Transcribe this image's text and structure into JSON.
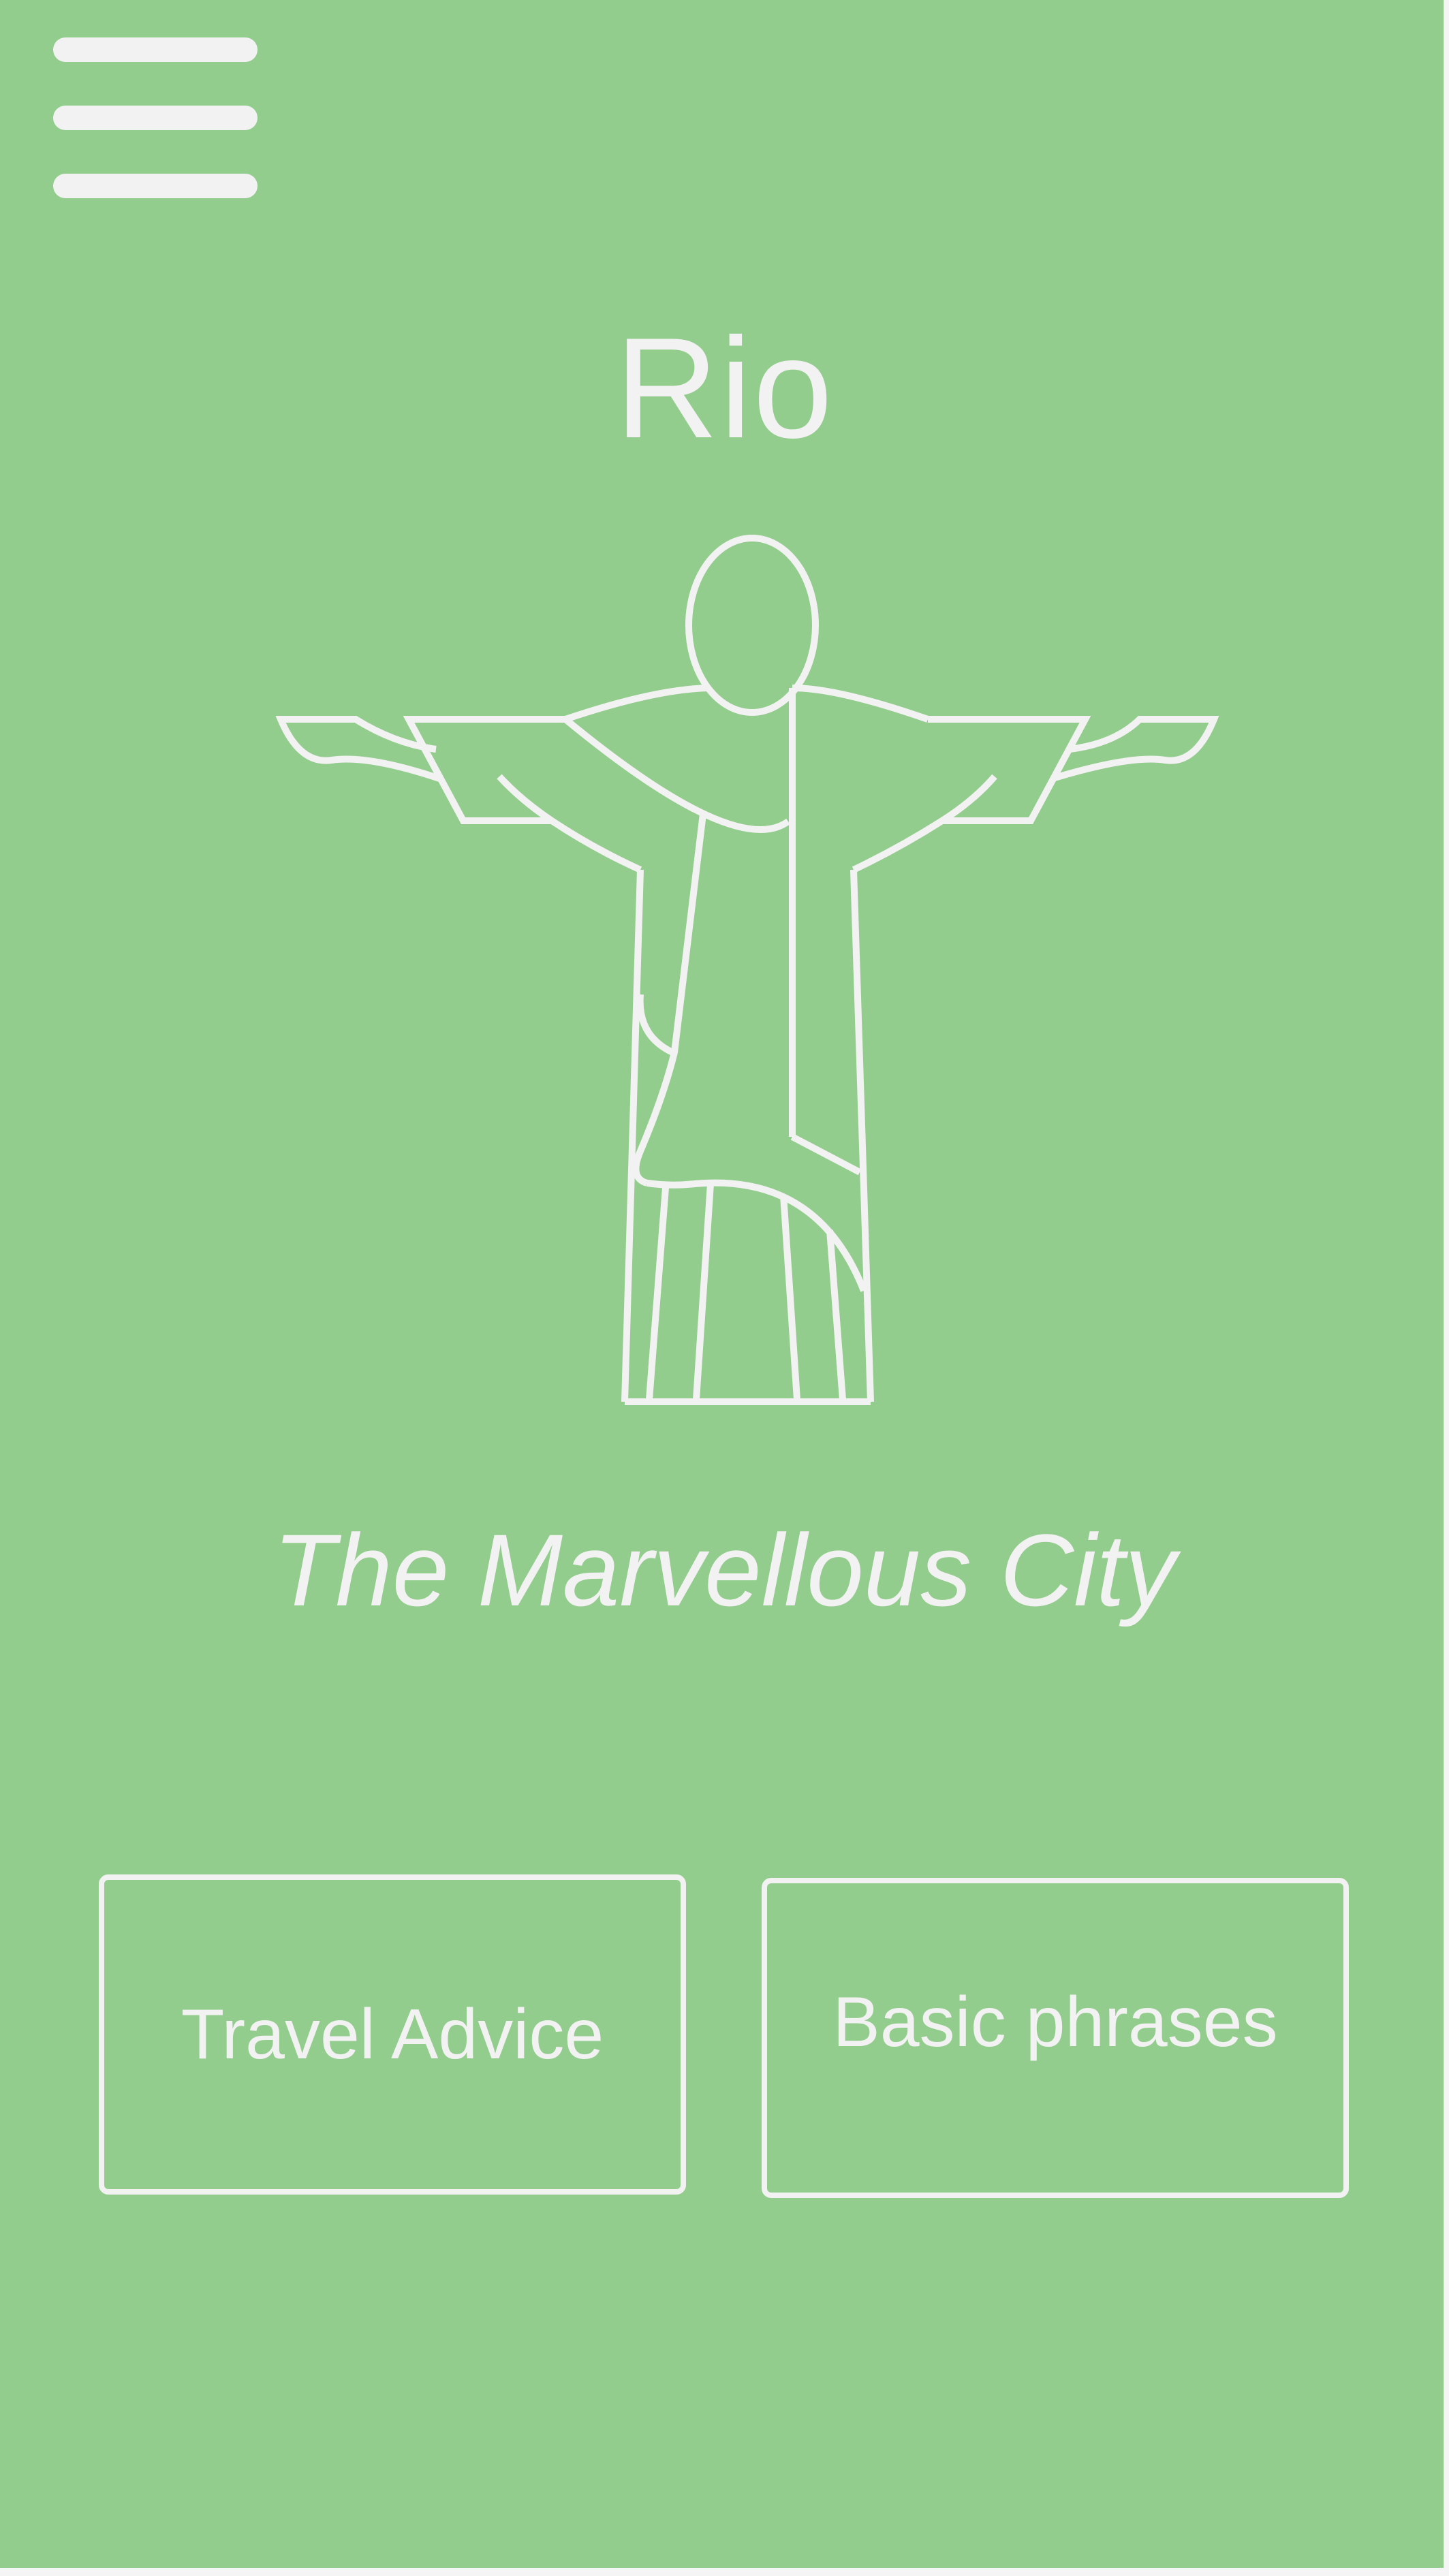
{
  "app": {
    "title": "Rio",
    "tagline": "The Marvellous City"
  },
  "header": {
    "menu_icon": "hamburger-menu-icon"
  },
  "hero": {
    "illustration_icon": "christ-the-redeemer-statue-icon"
  },
  "actions": {
    "travel_advice_label": "Travel Advice",
    "basic_phrases_label": "Basic phrases"
  },
  "colors": {
    "background": "#93cd8d",
    "foreground": "#f2f2f2"
  }
}
